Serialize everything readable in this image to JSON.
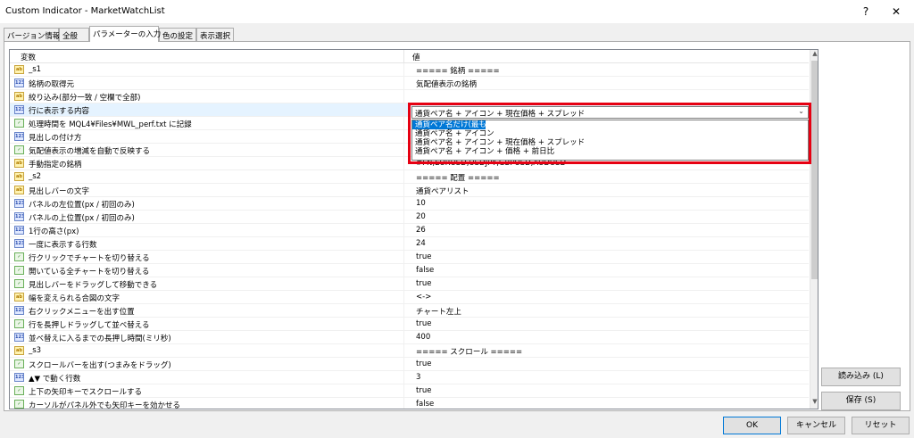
{
  "window": {
    "title": "Custom Indicator - MarketWatchList",
    "help": "?",
    "close": "✕"
  },
  "tabs": [
    {
      "label": "バージョン情報"
    },
    {
      "label": "全般"
    },
    {
      "label": "パラメーターの入力"
    },
    {
      "label": "色の設定"
    },
    {
      "label": "表示選択"
    }
  ],
  "grid": {
    "header": {
      "variable": "変数",
      "value": "値"
    },
    "rows": [
      {
        "type": "ab",
        "name": "_s1",
        "value": "===== 銘柄 ====="
      },
      {
        "type": "123",
        "name": "銘柄の取得元",
        "value": "気配値表示の銘柄"
      },
      {
        "type": "ab",
        "name": "絞り込み(部分一致 / 空欄で全部)",
        "value": ""
      },
      {
        "type": "123",
        "name": "行に表示する内容",
        "value": ""
      },
      {
        "type": "bool",
        "name": "処理時間を MQL4¥Files¥MWL_perf.txt に記録",
        "value": ""
      },
      {
        "type": "123",
        "name": "見出しの付け方",
        "value": ""
      },
      {
        "type": "bool",
        "name": "気配値表示の増減を自動で反映する",
        "value": ""
      },
      {
        "type": "ab",
        "name": "手動指定の銘柄",
        "value": "#FN,EURUSD,USDJPY,GBPUSD,AUDUSD"
      },
      {
        "type": "ab",
        "name": "_s2",
        "value": "===== 配置 ====="
      },
      {
        "type": "ab",
        "name": "見出しバーの文字",
        "value": "通貨ペアリスト"
      },
      {
        "type": "123",
        "name": "パネルの左位置(px / 初回のみ)",
        "value": "10"
      },
      {
        "type": "123",
        "name": "パネルの上位置(px / 初回のみ)",
        "value": "20"
      },
      {
        "type": "123",
        "name": "1行の高さ(px)",
        "value": "26"
      },
      {
        "type": "123",
        "name": "一度に表示する行数",
        "value": "24"
      },
      {
        "type": "bool",
        "name": "行クリックでチャートを切り替える",
        "value": "true"
      },
      {
        "type": "bool",
        "name": "開いている全チャートを切り替える",
        "value": "false"
      },
      {
        "type": "bool",
        "name": "見出しバーをドラッグして移動できる",
        "value": "true"
      },
      {
        "type": "ab",
        "name": "幅を変えられる合図の文字",
        "value": "<->"
      },
      {
        "type": "123",
        "name": "右クリックメニューを出す位置",
        "value": "チャート左上"
      },
      {
        "type": "bool",
        "name": "行を長押しドラッグして並べ替える",
        "value": "true"
      },
      {
        "type": "123",
        "name": "並べ替えに入るまでの長押し時間(ミリ秒)",
        "value": "400"
      },
      {
        "type": "ab",
        "name": "_s3",
        "value": "===== スクロール ====="
      },
      {
        "type": "bool",
        "name": "スクロールバーを出す(つまみをドラッグ)",
        "value": "true"
      },
      {
        "type": "123",
        "name": "▲▼ で動く行数",
        "value": "3"
      },
      {
        "type": "bool",
        "name": "上下の矢印キーでスクロールする",
        "value": "true"
      },
      {
        "type": "bool",
        "name": "カーソルがパネル外でも矢印キーを効かせる",
        "value": "false"
      }
    ]
  },
  "combo": {
    "selected": "通貨ペア名 + アイコン + 現在価格 + スプレッド",
    "options": [
      "通貨ペア名だけ(最も軽い)",
      "通貨ペア名 + アイコン",
      "通貨ペア名 + アイコン + 現在価格 + スプレッド",
      "通貨ペア名 + アイコン + 価格 + 前日比"
    ]
  },
  "side_buttons": {
    "load": "読み込み (L)",
    "save": "保存 (S)"
  },
  "bottom_buttons": {
    "ok": "OK",
    "cancel": "キャンセル",
    "reset": "リセット"
  },
  "colors": {
    "highlight": "#0078d7",
    "annotation_box": "#e60012"
  }
}
